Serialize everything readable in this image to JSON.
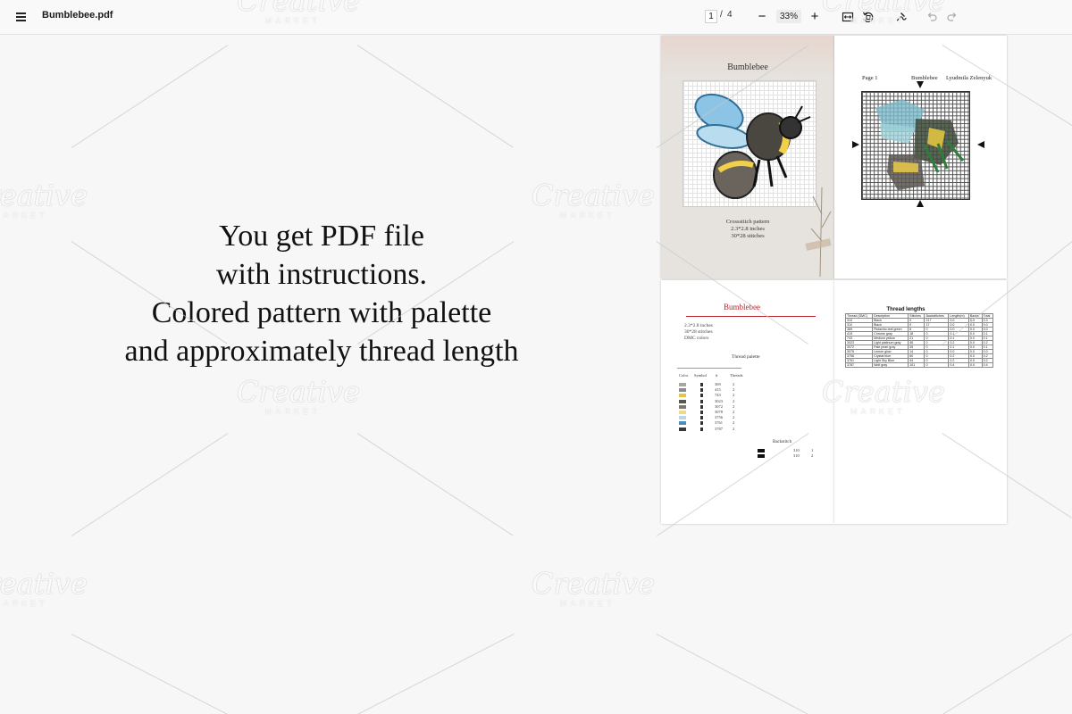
{
  "toolbar": {
    "file_name": "Bumblebee.pdf",
    "current_page": "1",
    "page_separator": "/",
    "total_pages": "4",
    "zoom_out_symbol": "−",
    "zoom_level": "33%",
    "zoom_in_symbol": "+",
    "icons": [
      "menu-icon",
      "fit-page-icon",
      "rotate-icon",
      "draw-icon",
      "undo-icon",
      "redo-icon"
    ]
  },
  "caption": {
    "line1": "You get PDF file",
    "line2": "with instructions.",
    "line3": "Colored pattern with palette",
    "line4": "and approximately thread length"
  },
  "watermark": {
    "text": "Creative",
    "sub": "MARKET"
  },
  "pages": {
    "cover": {
      "title": "Bumblebee",
      "info_line1": "Crossstitch pattern",
      "info_line2": "2.3*2.8 inches",
      "info_line3": "30*28 stitches"
    },
    "chart_page": {
      "page_label": "Page 1",
      "pattern_name": "Bumblebee",
      "author": "Lyudmila Zelenyuk"
    },
    "palette_page": {
      "title": "Bumblebee",
      "meta1": "2.3*2.8 inches",
      "meta2": "30*28 stitches",
      "meta3": "DMC colors",
      "palette_heading": "Thread palette",
      "columns": [
        "Color",
        "Symbol",
        "#",
        "Threads"
      ],
      "rows": [
        {
          "color": "#a8a89a",
          "num": "369",
          "threads": "2"
        },
        {
          "color": "#8c8c8c",
          "num": "415",
          "threads": "2"
        },
        {
          "color": "#e6c542",
          "num": "743",
          "threads": "2"
        },
        {
          "color": "#5a5650",
          "num": "3023",
          "threads": "2"
        },
        {
          "color": "#7d7a72",
          "num": "3072",
          "threads": "2"
        },
        {
          "color": "#f0d98a",
          "num": "3078",
          "threads": "2"
        },
        {
          "color": "#bcd6e6",
          "num": "3756",
          "threads": "2"
        },
        {
          "color": "#4d8fb8",
          "num": "3761",
          "threads": "2"
        },
        {
          "color": "#3a3a3a",
          "num": "3787",
          "threads": "2"
        }
      ],
      "backstitch_heading": "Backstitch",
      "backstitch_rows": [
        {
          "num": "310",
          "threads": "1"
        },
        {
          "num": "310",
          "threads": "2"
        }
      ]
    },
    "thread_page": {
      "title": "Thread lengths",
      "columns": [
        "Thread (DMC)",
        "Description",
        "Stitches",
        "Backstitches",
        "Length(m)",
        "Backs",
        "Total"
      ],
      "rows": [
        [
          "310",
          "Black",
          "0",
          "217",
          "0.0",
          "0.3",
          "0.3"
        ],
        [
          "310",
          "Black",
          "0",
          "17",
          "0.0",
          "0.0",
          "0.0"
        ],
        [
          "369",
          "Pistachio leaf green",
          "8",
          "0",
          "0.0",
          "0.0",
          "0.0"
        ],
        [
          "415",
          "Chrome gray",
          "18",
          "0",
          "0.1",
          "0.0",
          "0.1"
        ],
        [
          "743",
          "Medium yellow",
          "21",
          "0",
          "0.1",
          "0.0",
          "0.1"
        ],
        [
          "3023",
          "Light platinum gray",
          "46",
          "0",
          "0.2",
          "0.0",
          "0.2"
        ],
        [
          "3072",
          "Pale pearl gray",
          "35",
          "0",
          "0.1",
          "0.0",
          "0.1"
        ],
        [
          "3078",
          "Lemon glow",
          "14",
          "0",
          "0.0",
          "0.0",
          "0.0"
        ],
        [
          "3756",
          "Crystal blue",
          "60",
          "0",
          "0.2",
          "0.0",
          "0.2"
        ],
        [
          "3761",
          "Light Sky Blue",
          "44",
          "0",
          "0.2",
          "0.0",
          "0.2"
        ],
        [
          "3787",
          "Wolf gray",
          "101",
          "0",
          "0.4",
          "0.0",
          "0.4"
        ]
      ]
    }
  }
}
